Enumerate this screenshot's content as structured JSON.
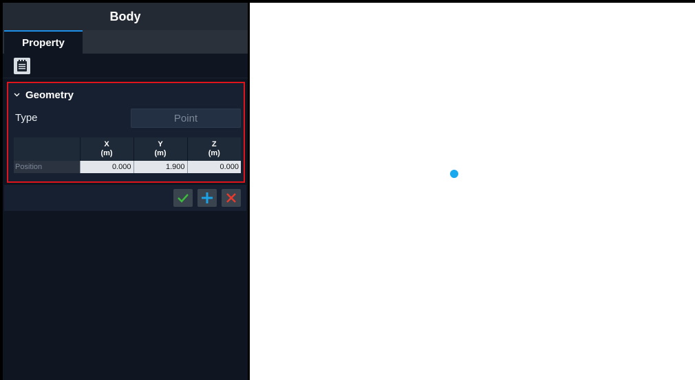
{
  "panel": {
    "title": "Body",
    "tabs": [
      {
        "label": "Property",
        "active": true
      }
    ]
  },
  "geometry": {
    "section_title": "Geometry",
    "type_label": "Type",
    "type_value": "Point",
    "table": {
      "columns": [
        {
          "axis": "X",
          "unit": "(m)"
        },
        {
          "axis": "Y",
          "unit": "(m)"
        },
        {
          "axis": "Z",
          "unit": "(m)"
        }
      ],
      "rows": [
        {
          "label": "Position",
          "values": [
            "0.000",
            "1.900",
            "0.000"
          ]
        }
      ]
    }
  },
  "actions": {
    "icons": [
      "check-icon",
      "plus-icon",
      "close-icon"
    ],
    "colors": {
      "check": "#3dbb3d",
      "plus": "#1ba3e8",
      "close": "#e83b2e"
    }
  },
  "viewport": {
    "marker_color": "#19a9ee"
  },
  "colors": {
    "highlight_border": "#e0141b",
    "tab_accent": "#1e8fe6"
  }
}
